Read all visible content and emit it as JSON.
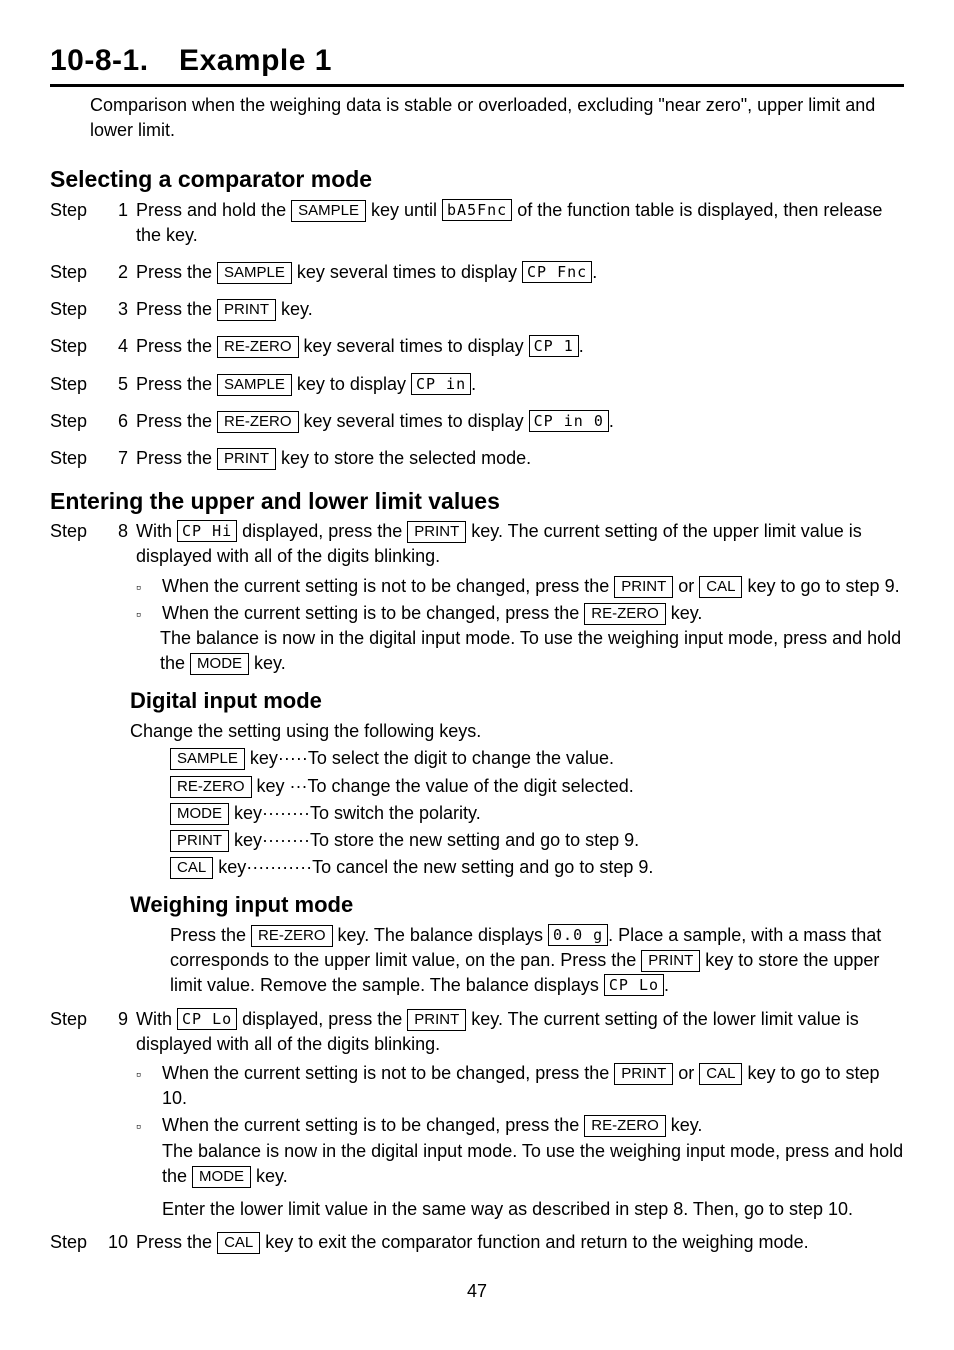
{
  "section_title": "10-8-1. Example 1",
  "section_intro": "Comparison when the weighing data is stable or overloaded, excluding \"near zero\", upper limit and lower limit.",
  "sub_select": "Selecting a comparator mode",
  "step1_a": "Press and hold the ",
  "step1_b": " key until ",
  "step1_c": " of the function table is displayed, then release the key.",
  "step2_a": "Press the ",
  "step2_b": " key several times to display ",
  "step3_a": "Press the ",
  "step3_b": " key.",
  "step4_a": "Press the ",
  "step4_b": " key several times to display ",
  "step5_a": "Press the ",
  "step5_b": " key to display ",
  "step6_a": "Press the ",
  "step6_b": " key several times to display ",
  "step7_a": "Press the ",
  "step7_b": " key to store the selected mode.",
  "sub_enter": "Entering the upper and lower limit values",
  "step8_a": "With ",
  "step8_b": " displayed, press the ",
  "step8_c": " key. The current setting of the upper limit value is displayed with all of the digits blinking.",
  "b8_1a": "When the current setting is not to be changed, press the ",
  "b8_1b": " or ",
  "b8_1c": " key to go to step 9.",
  "b8_2a": "When the current setting is to be changed, press the ",
  "b8_2b": " key.",
  "b8_2c": "The balance is now in the digital input mode. To use the weighing input mode, press and hold the ",
  "b8_2d": " key.",
  "sub_digital": "Digital input mode",
  "dig_intro": "Change the setting using the following keys.",
  "dig_sample": " key·····To select the digit to change the value.",
  "dig_rezero": " key ···To change the value of the digit selected.",
  "dig_mode": " key········To switch the polarity.",
  "dig_print": " key········To store the new setting and go to step 9.",
  "dig_cal": " key···········To cancel the new setting and go to step 9.",
  "sub_weigh": "Weighing input mode",
  "weigh_a": "Press the ",
  "weigh_b": " key. The balance displays ",
  "weigh_c": ". Place a sample, with a mass that   corresponds to the upper limit value, on the pan. Press the ",
  "weigh_d": " key to store the upper limit value. Remove the sample. The balance displays ",
  "step9_a": "With ",
  "step9_b": " displayed, press the ",
  "step9_c": " key. The current setting of the lower limit value is displayed with all of the digits blinking.",
  "b9_1a": "When the current setting is not to be changed, press the ",
  "b9_1b": " or ",
  "b9_1c": " key to go to step 10.",
  "b9_2a": "When the current setting is to be changed, press the ",
  "b9_2b": " key.",
  "b9_2c": "The balance is now in the digital input mode. To use the weighing input mode, press and hold the ",
  "b9_2d": " key.",
  "b9_2e": "Enter the lower limit value in the same way as described in step 8. Then, go to step 10.",
  "step10_a": "Press the ",
  "step10_b": " key to exit the comparator function and return to the weighing mode.",
  "keys": {
    "sample": "SAMPLE",
    "print": "PRINT",
    "rezero": "RE-ZERO",
    "mode": "MODE",
    "cal": "CAL"
  },
  "seg": {
    "basfnc": "bA5Fnc",
    "cpfnc": "CP Fnc",
    "cp1": "CP  1",
    "cpin": "CP in",
    "cpin0": "CP in 0",
    "cphi": "CP Hi",
    "cplo": "CP Lo",
    "zerog": "0.0 g"
  },
  "labels": {
    "step": "Step",
    "n1": "1",
    "n2": "2",
    "n3": "3",
    "n4": "4",
    "n5": "5",
    "n6": "6",
    "n7": "7",
    "n8": "8",
    "n9": "9",
    "n10": "10"
  },
  "pagenum": "47"
}
